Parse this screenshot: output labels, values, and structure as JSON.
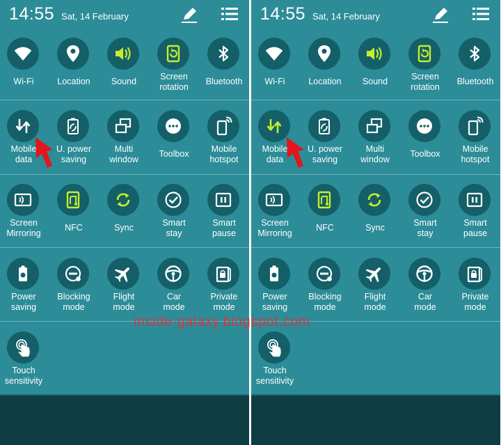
{
  "watermark": "inside-galaxy.blogspot.com",
  "colors": {
    "panel_bg": "#2c8c98",
    "icon_circle": "#145f68",
    "icon_white": "#ffffff",
    "icon_active": "#c6ee2a",
    "arrow_red": "#e4151d",
    "bottom_bar": "#0f3d44"
  },
  "panels": [
    {
      "status": {
        "time": "14:55",
        "date": "Sat, 14 February"
      },
      "mobile_data_active": false
    },
    {
      "status": {
        "time": "14:55",
        "date": "Sat, 14 February"
      },
      "mobile_data_active": true
    }
  ],
  "tiles": [
    {
      "key": "wifi",
      "label": "Wi-Fi",
      "icon": "wifi-icon"
    },
    {
      "key": "location",
      "label": "Location",
      "icon": "location-pin-icon"
    },
    {
      "key": "sound",
      "label": "Sound",
      "icon": "speaker-icon"
    },
    {
      "key": "screen-rotation",
      "label": "Screen\nrotation",
      "icon": "rotation-icon"
    },
    {
      "key": "bluetooth",
      "label": "Bluetooth",
      "icon": "bluetooth-icon"
    },
    {
      "key": "mobile-data",
      "label": "Mobile\ndata",
      "icon": "data-arrows-icon"
    },
    {
      "key": "u-power-saving",
      "label": "U. power\nsaving",
      "icon": "ultra-power-saving-icon"
    },
    {
      "key": "multi-window",
      "label": "Multi\nwindow",
      "icon": "multi-window-icon"
    },
    {
      "key": "toolbox",
      "label": "Toolbox",
      "icon": "toolbox-dots-icon"
    },
    {
      "key": "mobile-hotspot",
      "label": "Mobile\nhotspot",
      "icon": "hotspot-icon"
    },
    {
      "key": "screen-mirroring",
      "label": "Screen\nMirroring",
      "icon": "screen-mirroring-icon"
    },
    {
      "key": "nfc",
      "label": "NFC",
      "icon": "nfc-icon"
    },
    {
      "key": "sync",
      "label": "Sync",
      "icon": "sync-icon"
    },
    {
      "key": "smart-stay",
      "label": "Smart\nstay",
      "icon": "smart-stay-icon"
    },
    {
      "key": "smart-pause",
      "label": "Smart\npause",
      "icon": "smart-pause-icon"
    },
    {
      "key": "power-saving",
      "label": "Power\nsaving",
      "icon": "power-saving-icon"
    },
    {
      "key": "blocking-mode",
      "label": "Blocking\nmode",
      "icon": "blocking-mode-icon"
    },
    {
      "key": "flight-mode",
      "label": "Flight\nmode",
      "icon": "airplane-icon"
    },
    {
      "key": "car-mode",
      "label": "Car\nmode",
      "icon": "steering-wheel-icon"
    },
    {
      "key": "private-mode",
      "label": "Private\nmode",
      "icon": "private-mode-icon"
    },
    {
      "key": "touch-sensitivity",
      "label": "Touch\nsensitivity",
      "icon": "touch-icon"
    }
  ],
  "active_tiles": [
    "sound",
    "screen-rotation",
    "nfc",
    "sync"
  ]
}
